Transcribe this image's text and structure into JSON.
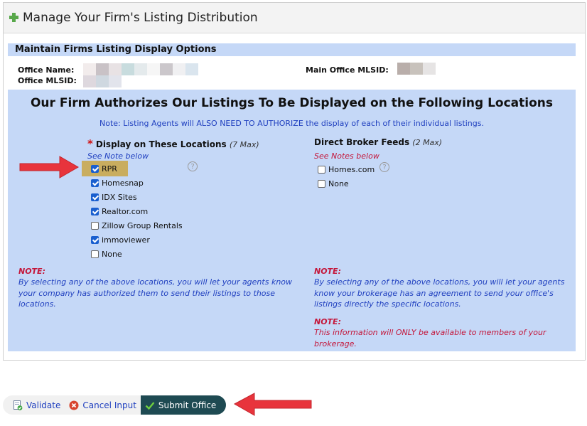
{
  "header": {
    "title": "Manage Your Firm's Listing Distribution"
  },
  "display_options": {
    "title": "Maintain Firms Listing Display Options",
    "office_name_label": "Office Name:",
    "office_mlsid_label": "Office MLSID:",
    "main_office_mlsid_label": "Main Office MLSID:"
  },
  "authorization": {
    "heading": "Our Firm Authorizes Our Listings To Be Displayed on the Following Locations",
    "note": "Note: Listing Agents will ALSO NEED TO AUTHORIZE the display of each of their individual listings."
  },
  "left_column": {
    "required_mark": "*",
    "title": "Display on These Locations",
    "max": "(7 Max)",
    "see_note": "See Note below",
    "options": [
      {
        "label": "RPR",
        "checked": true
      },
      {
        "label": "Homesnap",
        "checked": true
      },
      {
        "label": "IDX Sites",
        "checked": true
      },
      {
        "label": "Realtor.com",
        "checked": true
      },
      {
        "label": "Zillow Group Rentals",
        "checked": false
      },
      {
        "label": "immoviewer",
        "checked": true
      },
      {
        "label": "None",
        "checked": false
      }
    ],
    "note_title": "NOTE:",
    "note_text": [
      "By selecting any of the above locations, you will let your agents know",
      "your company has authorized them to send their listings to those",
      "locations."
    ]
  },
  "right_column": {
    "title": "Direct Broker Feeds",
    "max": "(2 Max)",
    "see_note": "See Notes below",
    "options": [
      {
        "label": "Homes.com",
        "checked": false
      },
      {
        "label": "None",
        "checked": false
      }
    ],
    "note1_title": "NOTE:",
    "note1_text": [
      "By selecting any of the above locations, you will let your agents",
      "know your brokerage has an agreement to send your office's",
      "listings directly the specific locations."
    ],
    "note2_title": "NOTE:",
    "note2_text": [
      "This information will ONLY be available to members of your",
      "brokerage."
    ]
  },
  "help_icon_glyph": "?",
  "buttons": {
    "validate": "Validate",
    "cancel": "Cancel Input",
    "submit": "Submit Office"
  },
  "colors": {
    "accent_blue": "#c5d8f7",
    "note_red": "#c4163a",
    "link_blue": "#1f3fbf",
    "arrow_red": "#e8343c",
    "submit_bg": "#1e4a52",
    "highlight": "#c9ad5f"
  }
}
